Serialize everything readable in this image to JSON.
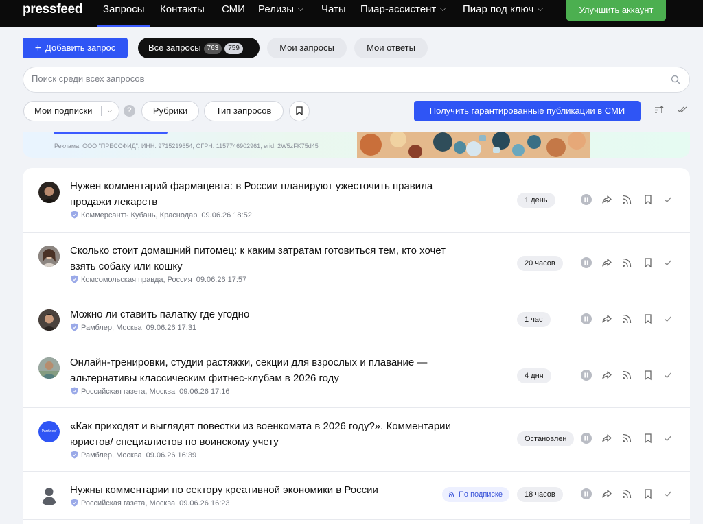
{
  "nav": {
    "logo": "pressfeed",
    "items": [
      "Запросы",
      "Контакты",
      "СМИ",
      "Релизы",
      "Чаты",
      "Пиар-ассистент",
      "Пиар под ключ"
    ],
    "upgrade": "Улучшить аккаунт"
  },
  "actions": {
    "add": "Добавить запрос",
    "all": "Все запросы",
    "all_count_a": "763",
    "all_count_b": "759",
    "mine": "Мои запросы",
    "answers": "Мои ответы"
  },
  "search": {
    "placeholder": "Поиск среди всех запросов"
  },
  "filters": {
    "subscriptions": "Мои подписки",
    "help": "?",
    "rubrics": "Рубрики",
    "type": "Тип запросов",
    "guaranteed": "Получить гарантированные публикации в СМИ"
  },
  "banner": {
    "legal": "Реклама: ООО \"ПРЕССФИД\", ИНН: 9715219654, ОГРН: 1157746902961, erid: 2W5zFK75d45"
  },
  "requests": [
    {
      "title": "Нужен комментарий фармацевта: в России планируют ужесточить правила продажи лекарств",
      "source": "Коммерсантъ Кубань, Краснодар",
      "date": "09.06.26 18:52",
      "time": "1 день",
      "tag": ""
    },
    {
      "title": "Сколько стоит домашний питомец: к каким затратам готовиться тем, кто хочет взять собаку или кошку",
      "source": "Комсомольская правда, Россия",
      "date": "09.06.26 17:57",
      "time": "20 часов",
      "tag": ""
    },
    {
      "title": "Можно ли ставить палатку где угодно",
      "source": "Рамблер, Москва",
      "date": "09.06.26 17:31",
      "time": "1 час",
      "tag": ""
    },
    {
      "title": "Онлайн-тренировки, студии растяжки, секции для взрослых и плавание — альтернативы классическим фитнес-клубам в 2026 году",
      "source": "Российская газета, Москва",
      "date": "09.06.26 17:16",
      "time": "4 дня",
      "tag": ""
    },
    {
      "title": "«Как приходят и выглядят повестки из военкомата в 2026 году?». Комментарии юристов/ специалистов по воинскому учету",
      "source": "Рамблер, Москва",
      "date": "09.06.26 16:39",
      "time": "Остановлен",
      "tag": "",
      "avatar_text": "Рамблер/"
    },
    {
      "title": "Нужны комментарии по сектору креативной экономики в России",
      "source": "Российская газета, Москва",
      "date": "09.06.26 16:23",
      "time": "18 часов",
      "tag": "По подписке"
    }
  ],
  "colors": {
    "accent": "#2f55f5",
    "upgrade": "#4caf50",
    "topbar": "#0b0b0b"
  }
}
